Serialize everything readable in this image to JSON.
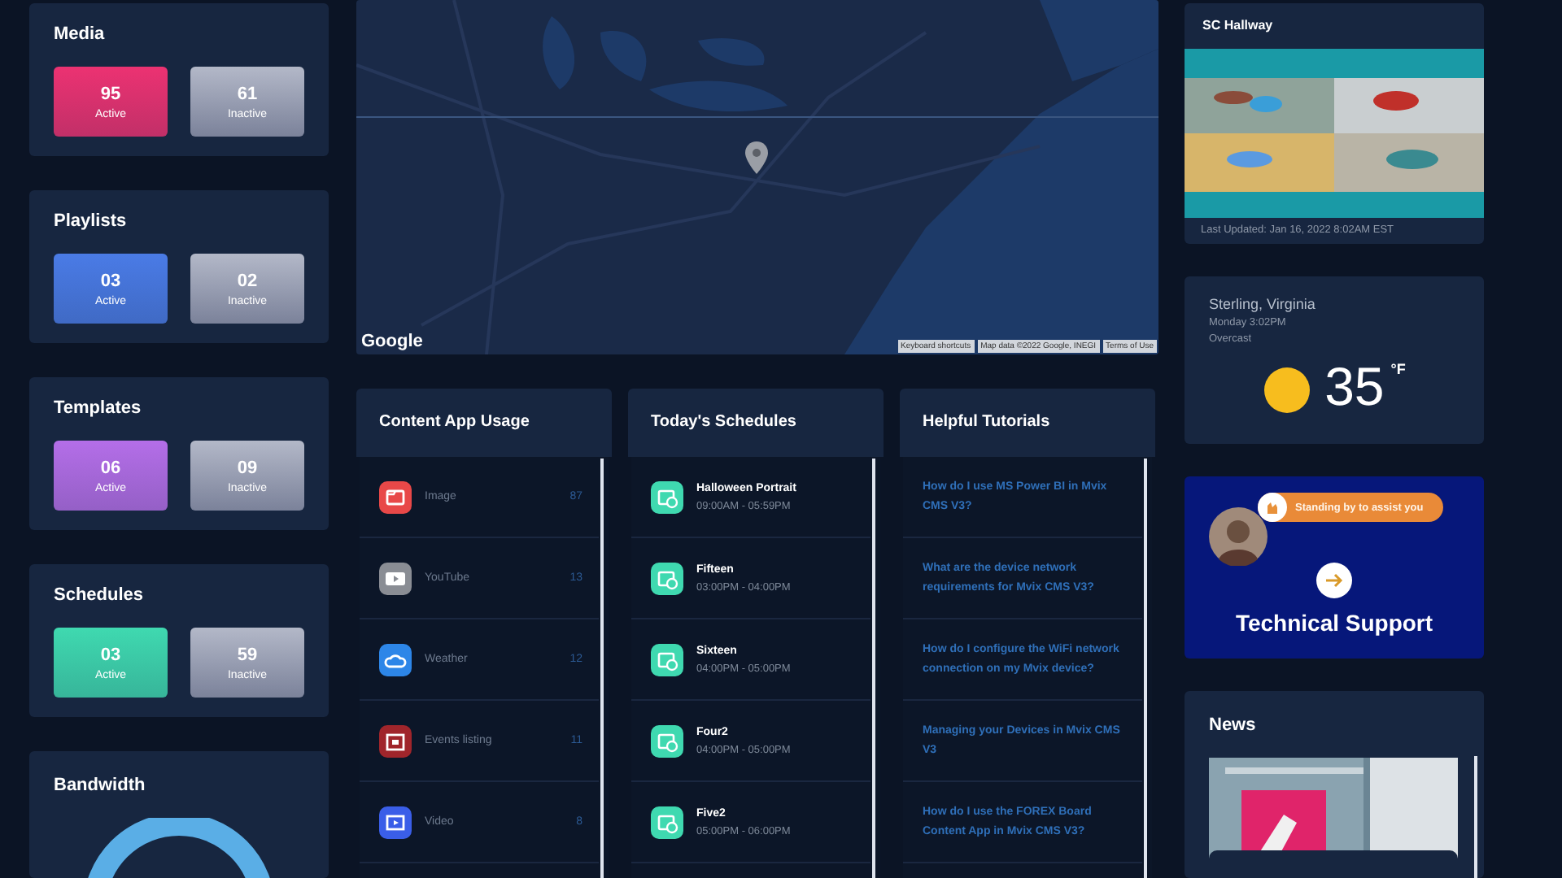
{
  "stats": [
    {
      "title": "Media",
      "active": {
        "value": "95",
        "label": "Active",
        "color": "#ec3272"
      },
      "inactive": {
        "value": "61",
        "label": "Inactive"
      }
    },
    {
      "title": "Playlists",
      "active": {
        "value": "03",
        "label": "Active",
        "color": "#4a7be6"
      },
      "inactive": {
        "value": "02",
        "label": "Inactive"
      }
    },
    {
      "title": "Templates",
      "active": {
        "value": "06",
        "label": "Active",
        "color": "#b46ee8"
      },
      "inactive": {
        "value": "09",
        "label": "Inactive"
      }
    },
    {
      "title": "Schedules",
      "active": {
        "value": "03",
        "label": "Active",
        "color": "#3fd9b0"
      },
      "inactive": {
        "value": "59",
        "label": "Inactive"
      }
    }
  ],
  "bandwidth": {
    "title": "Bandwidth"
  },
  "map": {
    "kind": "picture",
    "logo": "Google",
    "attributions": [
      "Keyboard shortcuts",
      "Map data ©2022 Google, INEGI",
      "Terms of Use"
    ]
  },
  "app_usage": {
    "title": "Content App Usage",
    "rows": [
      {
        "name": "Image",
        "count": "87",
        "kind": "folder",
        "color": "#e84848"
      },
      {
        "name": "YouTube",
        "count": "13",
        "kind": "play",
        "color": "#8a8d94"
      },
      {
        "name": "Weather",
        "count": "12",
        "kind": "cloud",
        "color": "#2d86e8"
      },
      {
        "name": "Events listing",
        "count": "11",
        "kind": "calendar",
        "color": "#a0252b"
      },
      {
        "name": "Video",
        "count": "8",
        "kind": "film",
        "color": "#3a5ee8"
      }
    ]
  },
  "schedules": {
    "title": "Today's Schedules",
    "rows": [
      {
        "name": "Halloween Portrait",
        "time": "09:00AM - 05:59PM"
      },
      {
        "name": "Fifteen",
        "time": "03:00PM - 04:00PM"
      },
      {
        "name": "Sixteen",
        "time": "04:00PM - 05:00PM"
      },
      {
        "name": "Four2",
        "time": "04:00PM - 05:00PM"
      },
      {
        "name": "Five2",
        "time": "05:00PM - 06:00PM"
      }
    ]
  },
  "tutorials": {
    "title": "Helpful Tutorials",
    "links": [
      "How do I use MS Power BI in Mvix CMS V3?",
      "What are the device network requirements for Mvix CMS V3?",
      "How do I configure the WiFi network connection on my Mvix device?",
      "Managing your Devices in Mvix CMS V3",
      "How do I use the FOREX Board Content App in Mvix CMS V3?"
    ]
  },
  "screen": {
    "title": "SC Hallway",
    "updated": "Last Updated: Jan 16, 2022 8:02AM EST"
  },
  "weather": {
    "location": "Sterling, Virginia",
    "day_time": "Monday 3:02PM",
    "condition": "Overcast",
    "temperature": "35",
    "unit": "°F"
  },
  "support": {
    "bubble": "Standing by to assist you",
    "title": "Technical Support"
  },
  "news": {
    "title": "News"
  }
}
